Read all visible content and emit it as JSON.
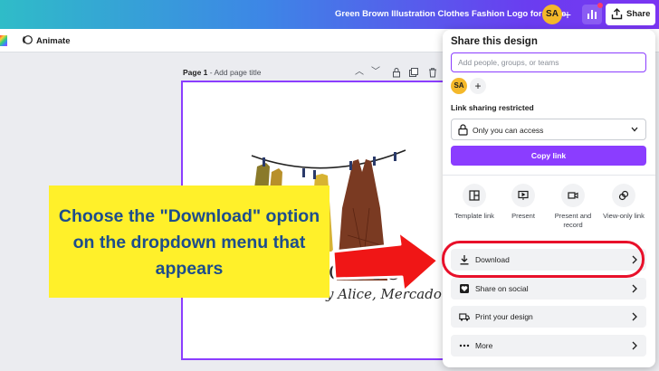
{
  "header": {
    "doc_title": "Green Brown Illustration Clothes Fashion Logo for Store",
    "avatar_initials": "SA",
    "share_label": "Share"
  },
  "toolbar": {
    "animate_label": "Animate"
  },
  "page": {
    "label": "Page 1",
    "title_placeholder": "Add page title"
  },
  "design": {
    "brand_text": "G STOR",
    "brand_sub": "y Alice, Mercado"
  },
  "callout": {
    "text": "Choose the \"Download\" option on the dropdown menu that appears"
  },
  "share_panel": {
    "title": "Share this design",
    "people_placeholder": "Add people, groups, or teams",
    "avatar_initials": "SA",
    "link_heading": "Link sharing restricted",
    "access_value": "Only you can access",
    "copy_link_label": "Copy link",
    "options": [
      {
        "label": "Template link",
        "icon": "template-icon"
      },
      {
        "label": "Present",
        "icon": "present-icon"
      },
      {
        "label": "Present and record",
        "icon": "camera-icon"
      },
      {
        "label": "View-only link",
        "icon": "link-icon"
      }
    ],
    "rows": [
      {
        "label": "Download",
        "icon": "download-icon"
      },
      {
        "label": "Share on social",
        "icon": "heart-icon"
      },
      {
        "label": "Print your design",
        "icon": "truck-icon"
      },
      {
        "label": "More",
        "icon": "more-icon"
      }
    ]
  },
  "colors": {
    "accent": "#8b3dff",
    "highlight": "#e8102a",
    "callout_bg": "#fff02a",
    "callout_text": "#1d4d8c"
  }
}
